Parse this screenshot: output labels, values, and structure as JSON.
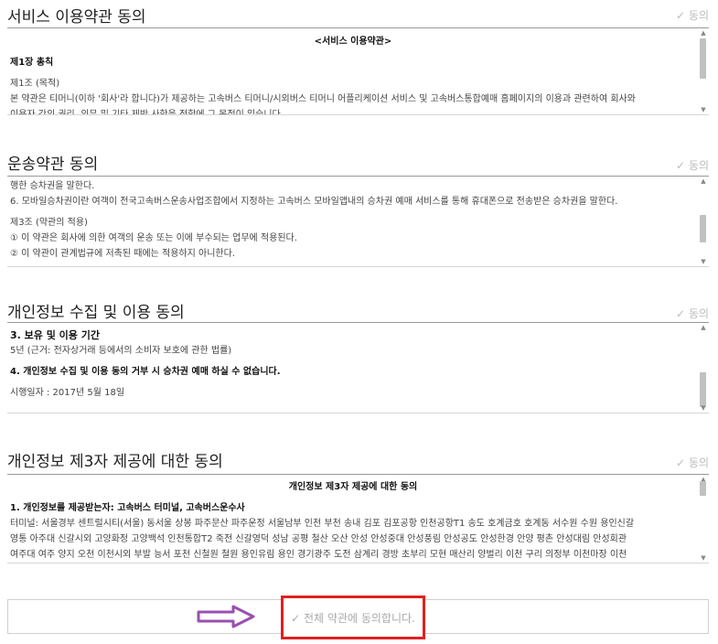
{
  "sections": [
    {
      "title": "서비스 이용약관 동의",
      "agree_label": "✓ 동의",
      "lines": [
        {
          "text": "<서비스 이용약관>",
          "style": "center"
        },
        {
          "text": "제1장 총칙",
          "style": "bold"
        },
        {
          "text": "제1조 (목적)",
          "style": "normal"
        },
        {
          "text": "본 약관은 티머니(이하 '회사'라 합니다)가 제공하는 고속버스 티머니/시외버스 티머니 어플리케이션 서비스 및 고속버스통합예매 홈페이지의 이용과 관련하여 회사와",
          "style": "normal"
        },
        {
          "text": "이용자 간의 권리, 의무 및 기타 제반 사항을 정함에 그 목적이 있습니다.",
          "style": "normal"
        }
      ]
    },
    {
      "title": "운송약관 동의",
      "agree_label": "✓ 동의",
      "lines": [
        {
          "text": "행한 승차권을 말한다.",
          "style": "normal"
        },
        {
          "text": "6. 모바일승차권이란 여객이 전국고속버스운송사업조합에서 지정하는 고속버스 모바일앱내의 승차권 예매 서비스를 통해 휴대폰으로 전송받은 승차권을 말한다.",
          "style": "normal"
        },
        {
          "text": "제3조 (약관의 적용)",
          "style": "normal"
        },
        {
          "text": "① 이 약관은 회사에 의한 여객의 운송 또는 이에 부수되는 업무에 적용된다.",
          "style": "normal"
        },
        {
          "text": "② 이 약관이 관계법규에 저촉된 때에는 적용하지 아니한다.",
          "style": "normal"
        }
      ]
    },
    {
      "title": "개인정보 수집 및 이용 동의",
      "agree_label": "✓ 동의",
      "lines": [
        {
          "text": "3. 보유 및 이용 기간",
          "style": "bold"
        },
        {
          "text": "5년 (근거: 전자상거래 등에서의 소비자 보호에 관한 법률)",
          "style": "normal"
        },
        {
          "text": "4. 개인정보 수집 및 이용 동의 거부 시 승차권 예매 하실 수 없습니다.",
          "style": "bold"
        },
        {
          "text": "시행일자 : 2017년 5월 18일",
          "style": "normal"
        }
      ]
    },
    {
      "title": "개인정보 제3자 제공에 대한 동의",
      "agree_label": "✓ 동의",
      "lines": [
        {
          "text": "개인정보 제3자 제공에 대한 동의",
          "style": "center"
        },
        {
          "text": "1. 개인정보를 제공받는자: 고속버스 터미널, 고속버스운수사",
          "style": "bold"
        },
        {
          "text": "터미널: 서울경부 센트럴시티(서울) 동서울 상봉 파주문산 파주운정 서울남부 인천 부천 송내 김포 김포공항 인천공항T1 송도 호계금호 호계동 서수원 수원 용인신갈",
          "style": "normal"
        },
        {
          "text": "영통 아주대 신갈시외 고양화정 고양백석 인천통합T2 죽전 신갈영덕 성남 공평 철산 오산 안성 안성중대 안성풍림 안성공도 안성한경 안양 평촌 안성대림 안성회관",
          "style": "normal"
        },
        {
          "text": "여주대 여주 양지 오천 이천시외 부발 능서 포천 신철원 철원 용인유림 용인 경기광주 도전 삼계리 경방 초부리 모현 매산리 양벌리 이천 구리 의정부 이천마장 이천",
          "style": "normal"
        }
      ]
    }
  ],
  "all_agree_label": "✓ 전체 약관에 동의합니다.",
  "colors": {
    "highlight": "#e02020",
    "arrow": "#9b4fb0",
    "agree_text": "#bbbbbb"
  }
}
